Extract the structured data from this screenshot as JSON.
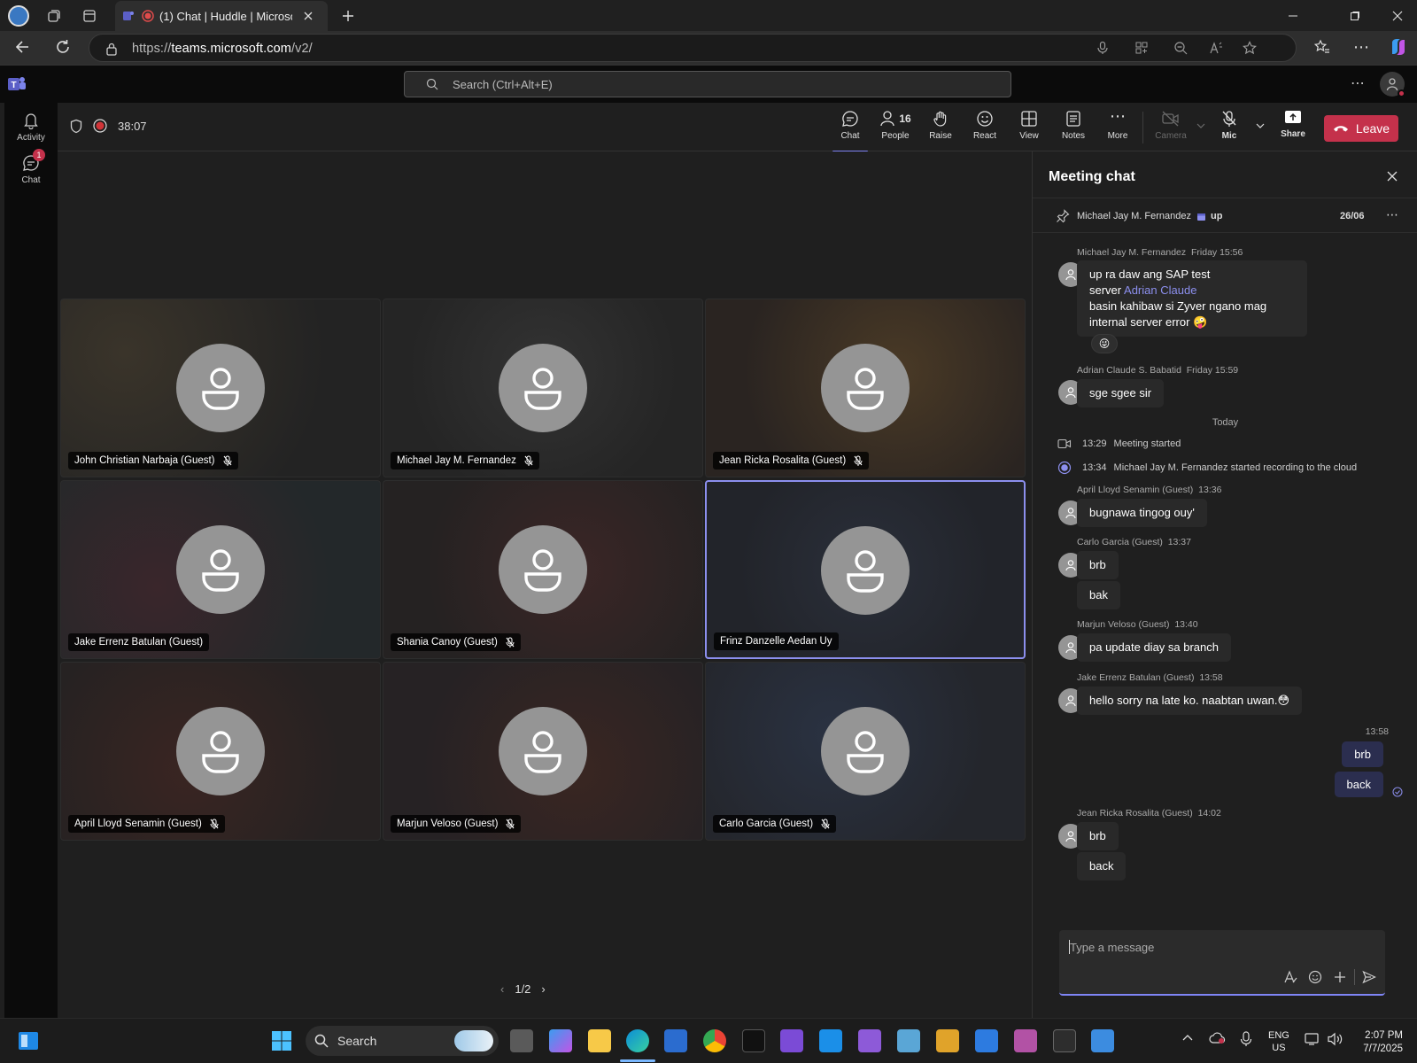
{
  "browser": {
    "tab_title": "(1) Chat | Huddle | Microsoft",
    "url_prefix": "https://",
    "url_host": "teams.microsoft.com",
    "url_path": "/v2/"
  },
  "teams": {
    "search_placeholder": "Search (Ctrl+Alt+E)",
    "rail": [
      {
        "label": "Activity",
        "icon": "bell-icon"
      },
      {
        "label": "Chat",
        "icon": "chat-icon",
        "badge": "1"
      }
    ]
  },
  "meeting": {
    "timer": "38:07",
    "toolbar": {
      "chat": "Chat",
      "people": "People",
      "people_count": "16",
      "raise": "Raise",
      "react": "React",
      "view": "View",
      "notes": "Notes",
      "more": "More",
      "camera": "Camera",
      "mic": "Mic",
      "share": "Share",
      "leave": "Leave"
    },
    "participants": [
      {
        "name": "John Christian Narbaja (Guest)",
        "muted": true
      },
      {
        "name": "Michael Jay M. Fernandez",
        "muted": true
      },
      {
        "name": "Jean Ricka Rosalita (Guest)",
        "muted": true
      },
      {
        "name": "Jake Errenz Batulan (Guest)",
        "muted": false
      },
      {
        "name": "Shania Canoy (Guest)",
        "muted": true
      },
      {
        "name": "Frinz Danzelle Aedan Uy",
        "muted": false,
        "active_speaker": true
      },
      {
        "name": "April Lloyd Senamin (Guest)",
        "muted": true
      },
      {
        "name": "Marjun Veloso (Guest)",
        "muted": true
      },
      {
        "name": "Carlo Garcia (Guest)",
        "muted": true
      }
    ],
    "pager": "1/2"
  },
  "chat": {
    "title": "Meeting chat",
    "pinned": {
      "author": "Michael Jay M. Fernandez",
      "text": "up",
      "date": "26/06"
    },
    "messages": [
      {
        "author": "Michael Jay M. Fernandez",
        "time": "Friday 15:56",
        "lines": [
          "up ra daw ang SAP test",
          "server",
          "basin kahibaw si Zyver ngano mag",
          "internal server error 🤪"
        ],
        "mention": "Adrian Claude",
        "reaction": "😜"
      },
      {
        "author": "Adrian Claude S. Babatid",
        "time": "Friday 15:59",
        "text": "sge sgee sir"
      },
      {
        "divider": "Today"
      },
      {
        "system_time": "13:29",
        "system_text": "Meeting started"
      },
      {
        "system_time": "13:34",
        "system_text": "Michael Jay M. Fernandez started recording to the cloud"
      },
      {
        "author": "April Lloyd Senamin (Guest)",
        "time": "13:36",
        "text": "bugnawa tingog ouy'"
      },
      {
        "author": "Carlo Garcia (Guest)",
        "time": "13:37",
        "text": "brb",
        "text2": "bak"
      },
      {
        "author": "Marjun Veloso (Guest)",
        "time": "13:40",
        "text": "pa update diay sa branch"
      },
      {
        "author": "Jake Errenz Batulan (Guest)",
        "time": "13:58",
        "text": "hello sorry na late ko. naabtan uwan.😳"
      },
      {
        "self": true,
        "time": "13:58",
        "text": "brb",
        "text2": "back"
      },
      {
        "author": "Jean Ricka Rosalita (Guest)",
        "time": "14:02",
        "text": "brb",
        "text2": "back"
      }
    ],
    "compose_placeholder": "Type a message"
  },
  "taskbar": {
    "search": "Search",
    "lang": "ENG",
    "region": "US",
    "time": "2:07 PM",
    "date": "7/7/2025"
  },
  "colors": {
    "accent": "#7f85f5",
    "leave": "#c4314b",
    "badge": "#c4314b"
  }
}
